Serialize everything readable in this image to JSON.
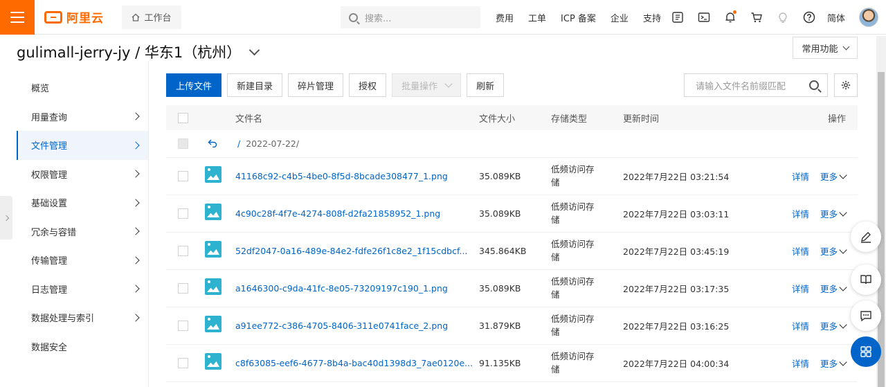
{
  "topbar": {
    "logo_text": "阿里云",
    "workbench_label": "工作台",
    "search_placeholder": "搜索...",
    "links": [
      "费用",
      "工单",
      "ICP 备案",
      "企业",
      "支持"
    ],
    "icons": [
      "app-icon",
      "terminal-icon",
      "bell-icon",
      "cart-icon",
      "bulb-icon",
      "help-icon"
    ],
    "lang": "简体"
  },
  "header": {
    "bucket_title": "gulimall-jerry-jy / 华东1（杭州）",
    "common_func_label": "常用功能"
  },
  "sidebar": {
    "items": [
      {
        "label": "概览",
        "arrow": false
      },
      {
        "label": "用量查询",
        "arrow": true
      },
      {
        "label": "文件管理",
        "arrow": true,
        "active": true
      },
      {
        "label": "权限管理",
        "arrow": true
      },
      {
        "label": "基础设置",
        "arrow": true
      },
      {
        "label": "冗余与容错",
        "arrow": true
      },
      {
        "label": "传输管理",
        "arrow": true
      },
      {
        "label": "日志管理",
        "arrow": true
      },
      {
        "label": "数据处理与索引",
        "arrow": true
      },
      {
        "label": "数据安全",
        "arrow": false
      }
    ]
  },
  "toolbar": {
    "upload": "上传文件",
    "new_dir": "新建目录",
    "fragments": "碎片管理",
    "authorize": "授权",
    "batch": "批量操作",
    "refresh": "刷新",
    "search_placeholder": "请输入文件名前缀匹配"
  },
  "table": {
    "headers": {
      "name": "文件名",
      "size": "文件大小",
      "type": "存储类型",
      "time": "更新时间",
      "op": "操作"
    },
    "path": {
      "slash": "/",
      "dir": "2022-07-22/"
    },
    "rows": [
      {
        "name": "41168c92-c4b5-4be0-8f5d-8bcade308477_1.png",
        "size": "35.089KB",
        "type": "低频访问存储",
        "time": "2022年7月22日 03:21:54"
      },
      {
        "name": "4c90c28f-4f7e-4274-808f-d2fa21858952_1.png",
        "size": "35.089KB",
        "type": "低频访问存储",
        "time": "2022年7月22日 03:03:11"
      },
      {
        "name": "52df2047-0a16-489e-84e2-fdfe26f1c8e2_1f15cdbcf...",
        "size": "345.864KB",
        "type": "低频访问存储",
        "time": "2022年7月22日 03:45:19"
      },
      {
        "name": "a1646300-c9da-41fc-8e05-73209197c190_1.png",
        "size": "35.089KB",
        "type": "低频访问存储",
        "time": "2022年7月22日 03:17:35"
      },
      {
        "name": "a91ee772-c386-4705-8406-311e0741face_2.png",
        "size": "31.879KB",
        "type": "低频访问存储",
        "time": "2022年7月22日 03:16:25"
      },
      {
        "name": "c8f63085-eef6-4677-8b4a-bac40d1398d3_7ae0120e...",
        "size": "91.135KB",
        "type": "低频访问存储",
        "time": "2022年7月22日 04:00:34"
      }
    ],
    "op_detail": "详情",
    "op_more": "更多"
  },
  "colors": {
    "brand": "#ff6a00",
    "accent": "#0064c8"
  }
}
